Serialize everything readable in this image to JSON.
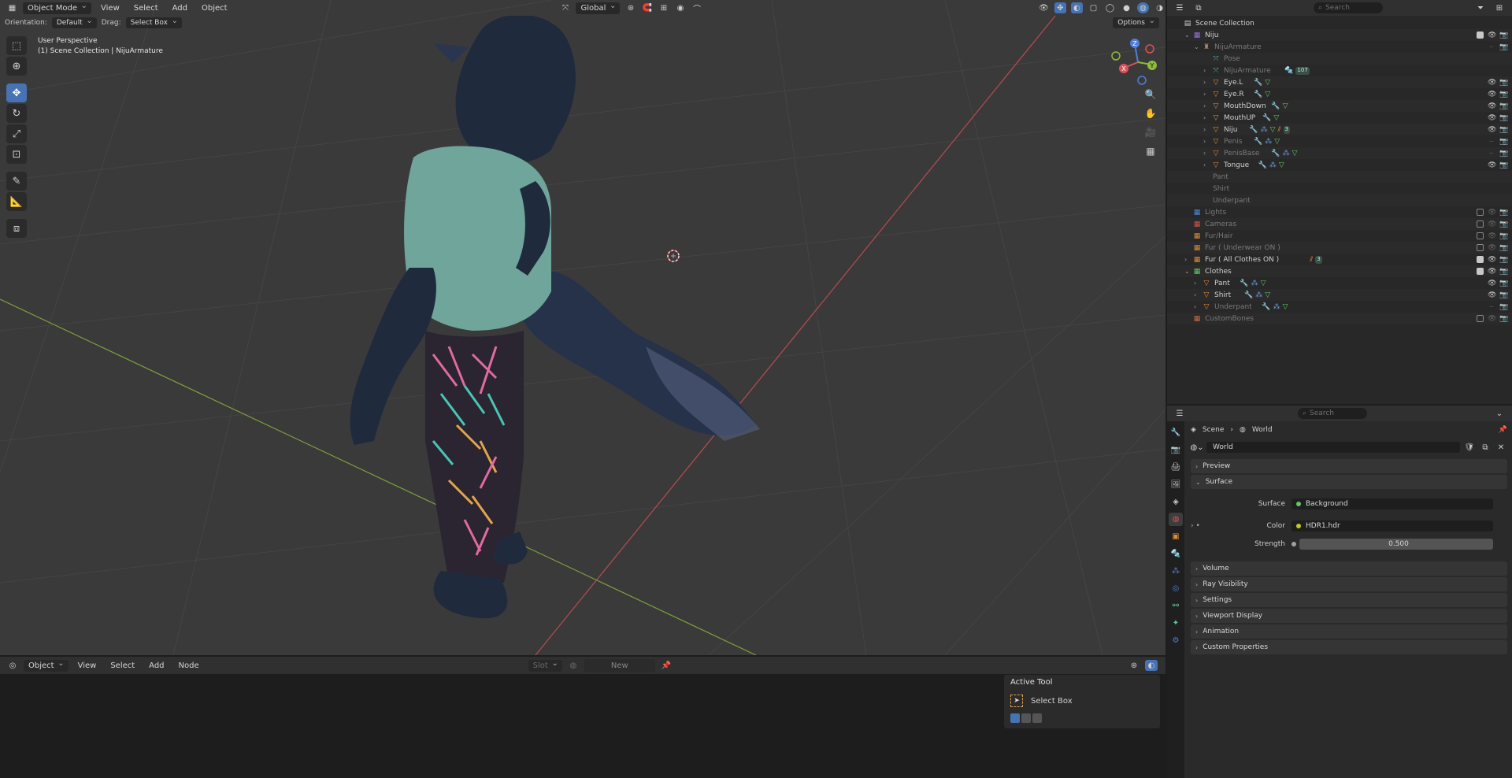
{
  "viewport": {
    "header": {
      "mode": "Object Mode",
      "menus": [
        "View",
        "Select",
        "Add",
        "Object"
      ],
      "transform_orientation": "Global"
    },
    "subheader": {
      "orientation_label": "Orientation:",
      "orientation_value": "Default",
      "drag_label": "Drag:",
      "drag_value": "Select Box",
      "options_label": "Options"
    },
    "overlay": {
      "perspective": "User Perspective",
      "collection": "(1) Scene Collection | NijuArmature"
    },
    "gizmo": {
      "z": "Z",
      "y": "Y",
      "x": "X"
    }
  },
  "node_editor": {
    "header": {
      "mode": "Object",
      "menus": [
        "View",
        "Select",
        "Add",
        "Node"
      ],
      "slot": "Slot",
      "new_label": "New"
    },
    "active_tool": {
      "title": "Active Tool",
      "tool_name": "Select Box"
    }
  },
  "outliner": {
    "search_placeholder": "Search",
    "rows": [
      {
        "label": "Scene Collection"
      },
      {
        "label": "Niju"
      },
      {
        "label": "NijuArmature"
      },
      {
        "label": "Pose"
      },
      {
        "label": "NijuArmature",
        "badge": "107"
      },
      {
        "label": "Eye.L"
      },
      {
        "label": "Eye.R"
      },
      {
        "label": "MouthDown"
      },
      {
        "label": "MouthUP"
      },
      {
        "label": "Niju",
        "badge": "3"
      },
      {
        "label": "Penis"
      },
      {
        "label": "PenisBase"
      },
      {
        "label": "Tongue"
      },
      {
        "label": "Pant"
      },
      {
        "label": "Shirt"
      },
      {
        "label": "Underpant"
      },
      {
        "label": "Lights"
      },
      {
        "label": "Cameras"
      },
      {
        "label": "Fur/Hair"
      },
      {
        "label": "Fur ( Underwear ON )"
      },
      {
        "label": "Fur ( All Clothes ON )",
        "badge": "3"
      },
      {
        "label": "Clothes"
      },
      {
        "label": "Pant"
      },
      {
        "label": "Shirt"
      },
      {
        "label": "Underpant"
      },
      {
        "label": "CustomBones"
      }
    ]
  },
  "properties": {
    "search_placeholder": "Search",
    "breadcrumb": {
      "scene": "Scene",
      "world": "World"
    },
    "world_name": "World",
    "panels": {
      "preview": "Preview",
      "surface": "Surface",
      "volume": "Volume",
      "ray_visibility": "Ray Visibility",
      "settings": "Settings",
      "viewport_display": "Viewport Display",
      "animation": "Animation",
      "custom_properties": "Custom Properties"
    },
    "surface": {
      "surface_label": "Surface",
      "surface_value": "Background",
      "color_label": "Color",
      "color_value": "HDR1.hdr",
      "strength_label": "Strength",
      "strength_value": "0.500"
    }
  },
  "colors": {
    "accent": "#4772b3",
    "viewport_bg": "#3a3a3a",
    "x_axis": "#e0505a",
    "y_axis": "#8bbd3a",
    "z_axis": "#4f7fd8"
  }
}
